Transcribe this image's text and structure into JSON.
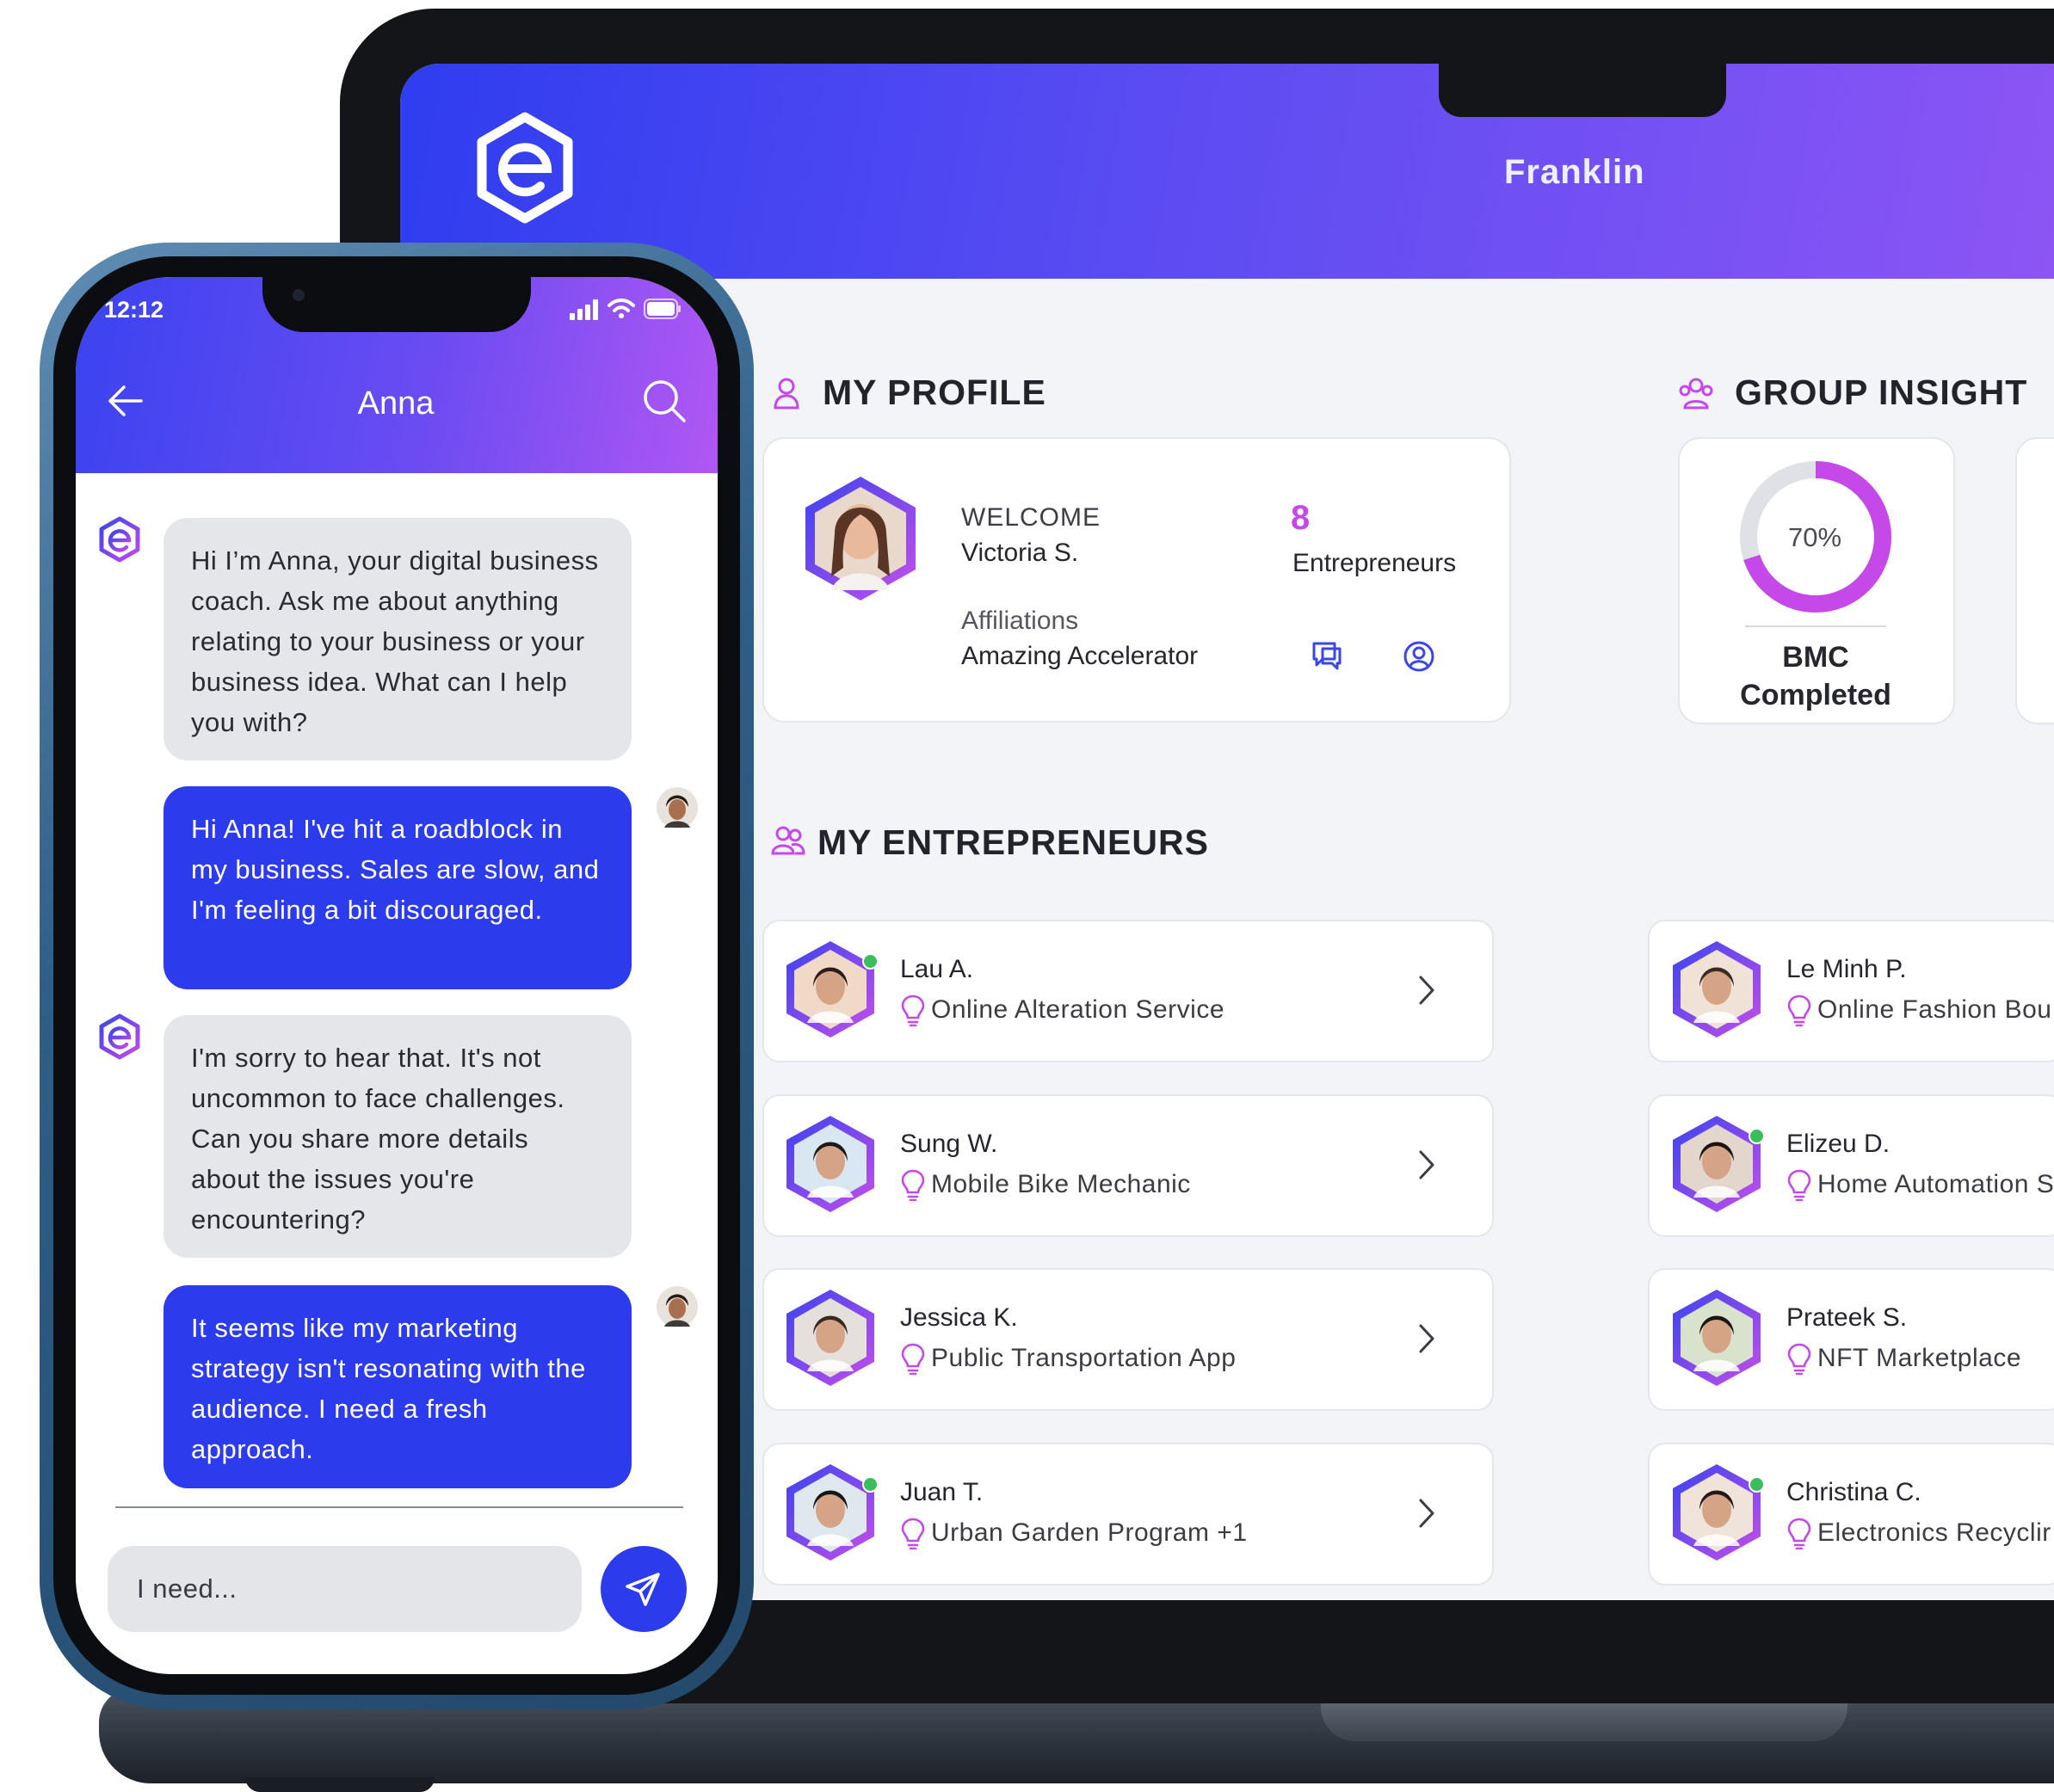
{
  "laptop": {
    "header": {
      "name": "Franklin"
    },
    "my_profile": {
      "title": "MY PROFILE",
      "welcome_label": "WELCOME",
      "user_name": "Victoria S.",
      "affiliations_label": "Affiliations",
      "affiliations_value": "Amazing Accelerator",
      "entrepreneurs_count": "8",
      "entrepreneurs_label": "Entrepreneurs"
    },
    "group_insight": {
      "title": "GROUP INSIGHT",
      "bmc_percent": "70%",
      "bmc_fraction": 0.7,
      "bmc_label_line1": "BMC",
      "bmc_label_line2": "Completed"
    },
    "my_entrepreneurs": {
      "title": "MY ENTREPRENEURS",
      "left": [
        {
          "name": "Lau A.",
          "business": "Online Alteration Service",
          "online": true
        },
        {
          "name": "Sung W.",
          "business": "Mobile Bike Mechanic",
          "online": false
        },
        {
          "name": "Jessica K.",
          "business": "Public Transportation App",
          "online": false
        },
        {
          "name": "Juan T.",
          "business": "Urban Garden Program +1",
          "online": true
        }
      ],
      "right": [
        {
          "name": "Le Minh P.",
          "business": "Online Fashion Bou",
          "online": false
        },
        {
          "name": "Elizeu D.",
          "business": "Home Automation S",
          "online": true
        },
        {
          "name": "Prateek S.",
          "business": "NFT Marketplace",
          "online": false
        },
        {
          "name": "Christina C.",
          "business": "Electronics Recyclir",
          "online": true
        }
      ]
    },
    "colors": {
      "accent": "#c548e8",
      "primary": "#2f3df0"
    }
  },
  "phone": {
    "status_time": "12:12",
    "chat_title": "Anna",
    "messages": [
      {
        "from": "bot",
        "text": "Hi I’m Anna, your digital business coach. Ask me about anything relating to your business or your business idea. What can I help you with?"
      },
      {
        "from": "user",
        "text": "Hi Anna! I've hit a roadblock in my business. Sales are slow, and I'm feeling a bit discouraged."
      },
      {
        "from": "bot",
        "text": "I'm sorry to hear that. It's not uncommon to face challenges. Can you share more details about the issues you're encountering?"
      },
      {
        "from": "user",
        "text": "It seems like my marketing strategy isn't resonating with the audience. I need a fresh approach."
      }
    ],
    "input_placeholder": "I need..."
  }
}
